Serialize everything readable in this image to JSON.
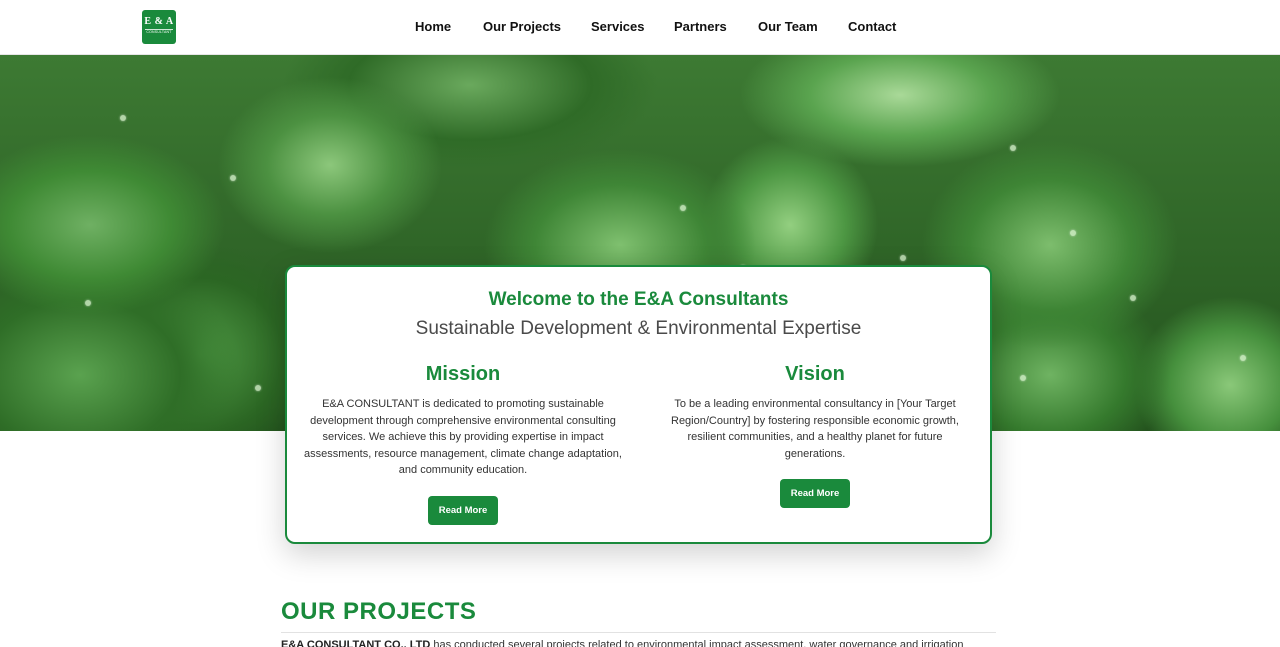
{
  "header": {
    "logo": {
      "line1": "E & A",
      "line2": "CONSULTANT"
    },
    "nav": [
      {
        "label": "Home"
      },
      {
        "label": "Our Projects"
      },
      {
        "label": "Services"
      },
      {
        "label": "Partners"
      },
      {
        "label": "Our Team"
      },
      {
        "label": "Contact"
      }
    ]
  },
  "hero": {
    "image": "spinach-leaves-with-water-droplets"
  },
  "welcome": {
    "title": "Welcome to the E&A Consultants",
    "subtitle": "Sustainable Development & Environmental Expertise",
    "mission": {
      "heading": "Mission",
      "text": "E&A CONSULTANT is dedicated to promoting sustainable development through comprehensive environmental consulting services. We achieve this by providing expertise in impact assessments, resource management, climate change adaptation, and community education.",
      "button": "Read More"
    },
    "vision": {
      "heading": "Vision",
      "text": "To be a leading environmental consultancy in [Your Target Region/Country] by fostering responsible economic growth, resilient communities, and a healthy planet for future generations.",
      "button": "Read More"
    }
  },
  "projects": {
    "title": "OUR PROJECTS",
    "company": "E&A CONSULTANT CO., LTD",
    "intro": " has conducted several projects related to environmental impact assessment, water governance and irrigation"
  },
  "colors": {
    "brand_green": "#1a8a3c"
  }
}
